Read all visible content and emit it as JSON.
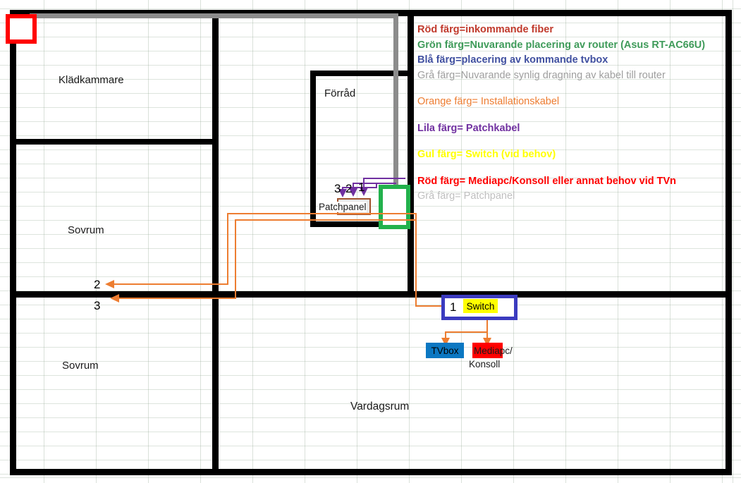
{
  "rooms": [
    {
      "id": "kladkammare",
      "label": "Klädkammare"
    },
    {
      "id": "sovrum-1",
      "label": "Sovrum"
    },
    {
      "id": "sovrum-2",
      "label": "Sovrum"
    },
    {
      "id": "forrad",
      "label": "Förråd"
    },
    {
      "id": "vardagsrum",
      "label": "Vardagsrum"
    }
  ],
  "legend": {
    "fiber": "Röd färg=inkommande fiber",
    "router": "Grön färg=Nuvarande placering av router (Asus RT-AC66U)",
    "tvbox": "Blå färg=placering av kommande tvbox",
    "gray_cable": "Grå färg=Nuvarande synlig dragning av kabel till router",
    "installation": "Orange färg= Installationskabel",
    "patchcable": "Lila färg= Patchkabel",
    "switch": "Gul färg= Switch (vid behov)",
    "mediapc": "Röd färg= Mediapc/Konsoll eller annat behov vid TVn",
    "patchpanel": "Grå färg= Patchpanel"
  },
  "legend_colors": {
    "fiber": "#c0392b",
    "router": "#3f9b5a",
    "tvbox": "#4050a0",
    "gray_cable": "#9e9e9e",
    "installation": "#ed7d31",
    "patchcable": "#7030a0",
    "switch": "#ffff00",
    "mediapc": "#ff0000",
    "patchpanel": "#bfbfbf"
  },
  "devices": {
    "patchpanel_label": "Patchpanel",
    "switch_label": "Switch",
    "switch_port": "1",
    "tvbox_label": "TVbox",
    "mediapc_label_top": "Mediapc/",
    "mediapc_label_bottom": "Konsoll"
  },
  "port_numbers": {
    "pp_3": "3",
    "pp_2": "2",
    "pp_1": "1",
    "cable_2": "2",
    "cable_3": "3"
  }
}
